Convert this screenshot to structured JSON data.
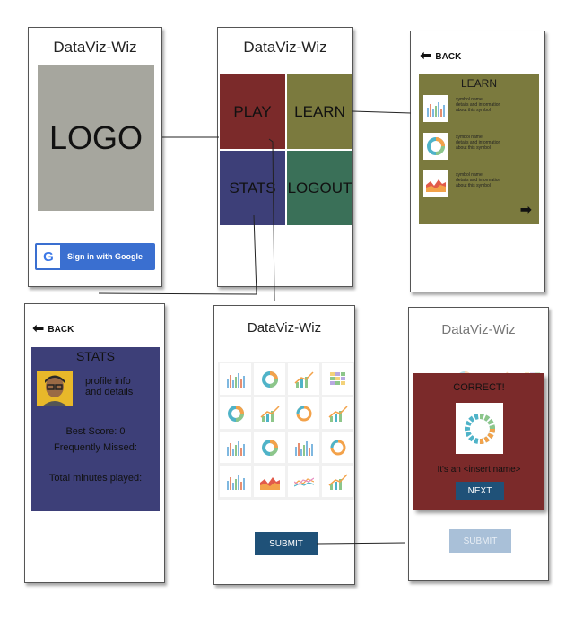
{
  "colors": {
    "play": "#7b2a2a",
    "learn": "#7b7a3e",
    "stats": "#3d3f78",
    "logout": "#3a7058",
    "logo_box": "#a6a69e",
    "google_button": "#3a6fd0",
    "submit": "#1f5178",
    "submit_disabled": "#a9c0d8"
  },
  "login_screen": {
    "title": "DataViz-Wiz",
    "logo_text": "LOGO",
    "google_glyph": "G",
    "google_label": "Sign in with Google"
  },
  "menu_screen": {
    "title": "DataViz-Wiz",
    "tiles": {
      "play": "PLAY",
      "learn": "LEARN",
      "stats": "STATS",
      "logout": "LOGOUT"
    }
  },
  "learn_screen": {
    "back_label": "BACK",
    "panel_title": "LEARN",
    "symbols": [
      {
        "icon": "bar-chart-icon",
        "line1": "symbol name:",
        "line2": "details and information",
        "line3": "about this symbol"
      },
      {
        "icon": "donut-chart-icon",
        "line1": "symbol name:",
        "line2": "details and information",
        "line3": "about this symbol"
      },
      {
        "icon": "area-chart-icon",
        "line1": "symbol name:",
        "line2": "details and information",
        "line3": "about this symbol"
      }
    ],
    "next_icon": "right-arrow-icon"
  },
  "stats_screen": {
    "back_label": "BACK",
    "panel_title": "STATS",
    "profile_line1": "profile info",
    "profile_line2": "and details",
    "best_score": "Best Score: 0",
    "frequently_missed": "Frequently Missed:",
    "total_minutes": "Total minutes played:"
  },
  "play_screen": {
    "title": "DataViz-Wiz",
    "grid_icons": [
      "bar-chart-icon",
      "donut-chart-icon",
      "growth-chart-icon",
      "heatmap-icon",
      "donut-chart-icon",
      "growth-chart-icon",
      "ring-chart-icon",
      "growth-chart-icon",
      "bar-chart-icon",
      "donut-chart-icon",
      "bar-chart-icon",
      "ring-chart-icon",
      "bar-chart-icon",
      "area-chart-icon",
      "wave-chart-icon",
      "growth-chart-icon"
    ],
    "submit_label": "SUBMIT"
  },
  "result_screen": {
    "title": "DataViz-Wiz",
    "modal_title": "CORRECT!",
    "modal_text": "It's an <insert name>",
    "next_label": "NEXT",
    "submit_label": "SUBMIT"
  }
}
